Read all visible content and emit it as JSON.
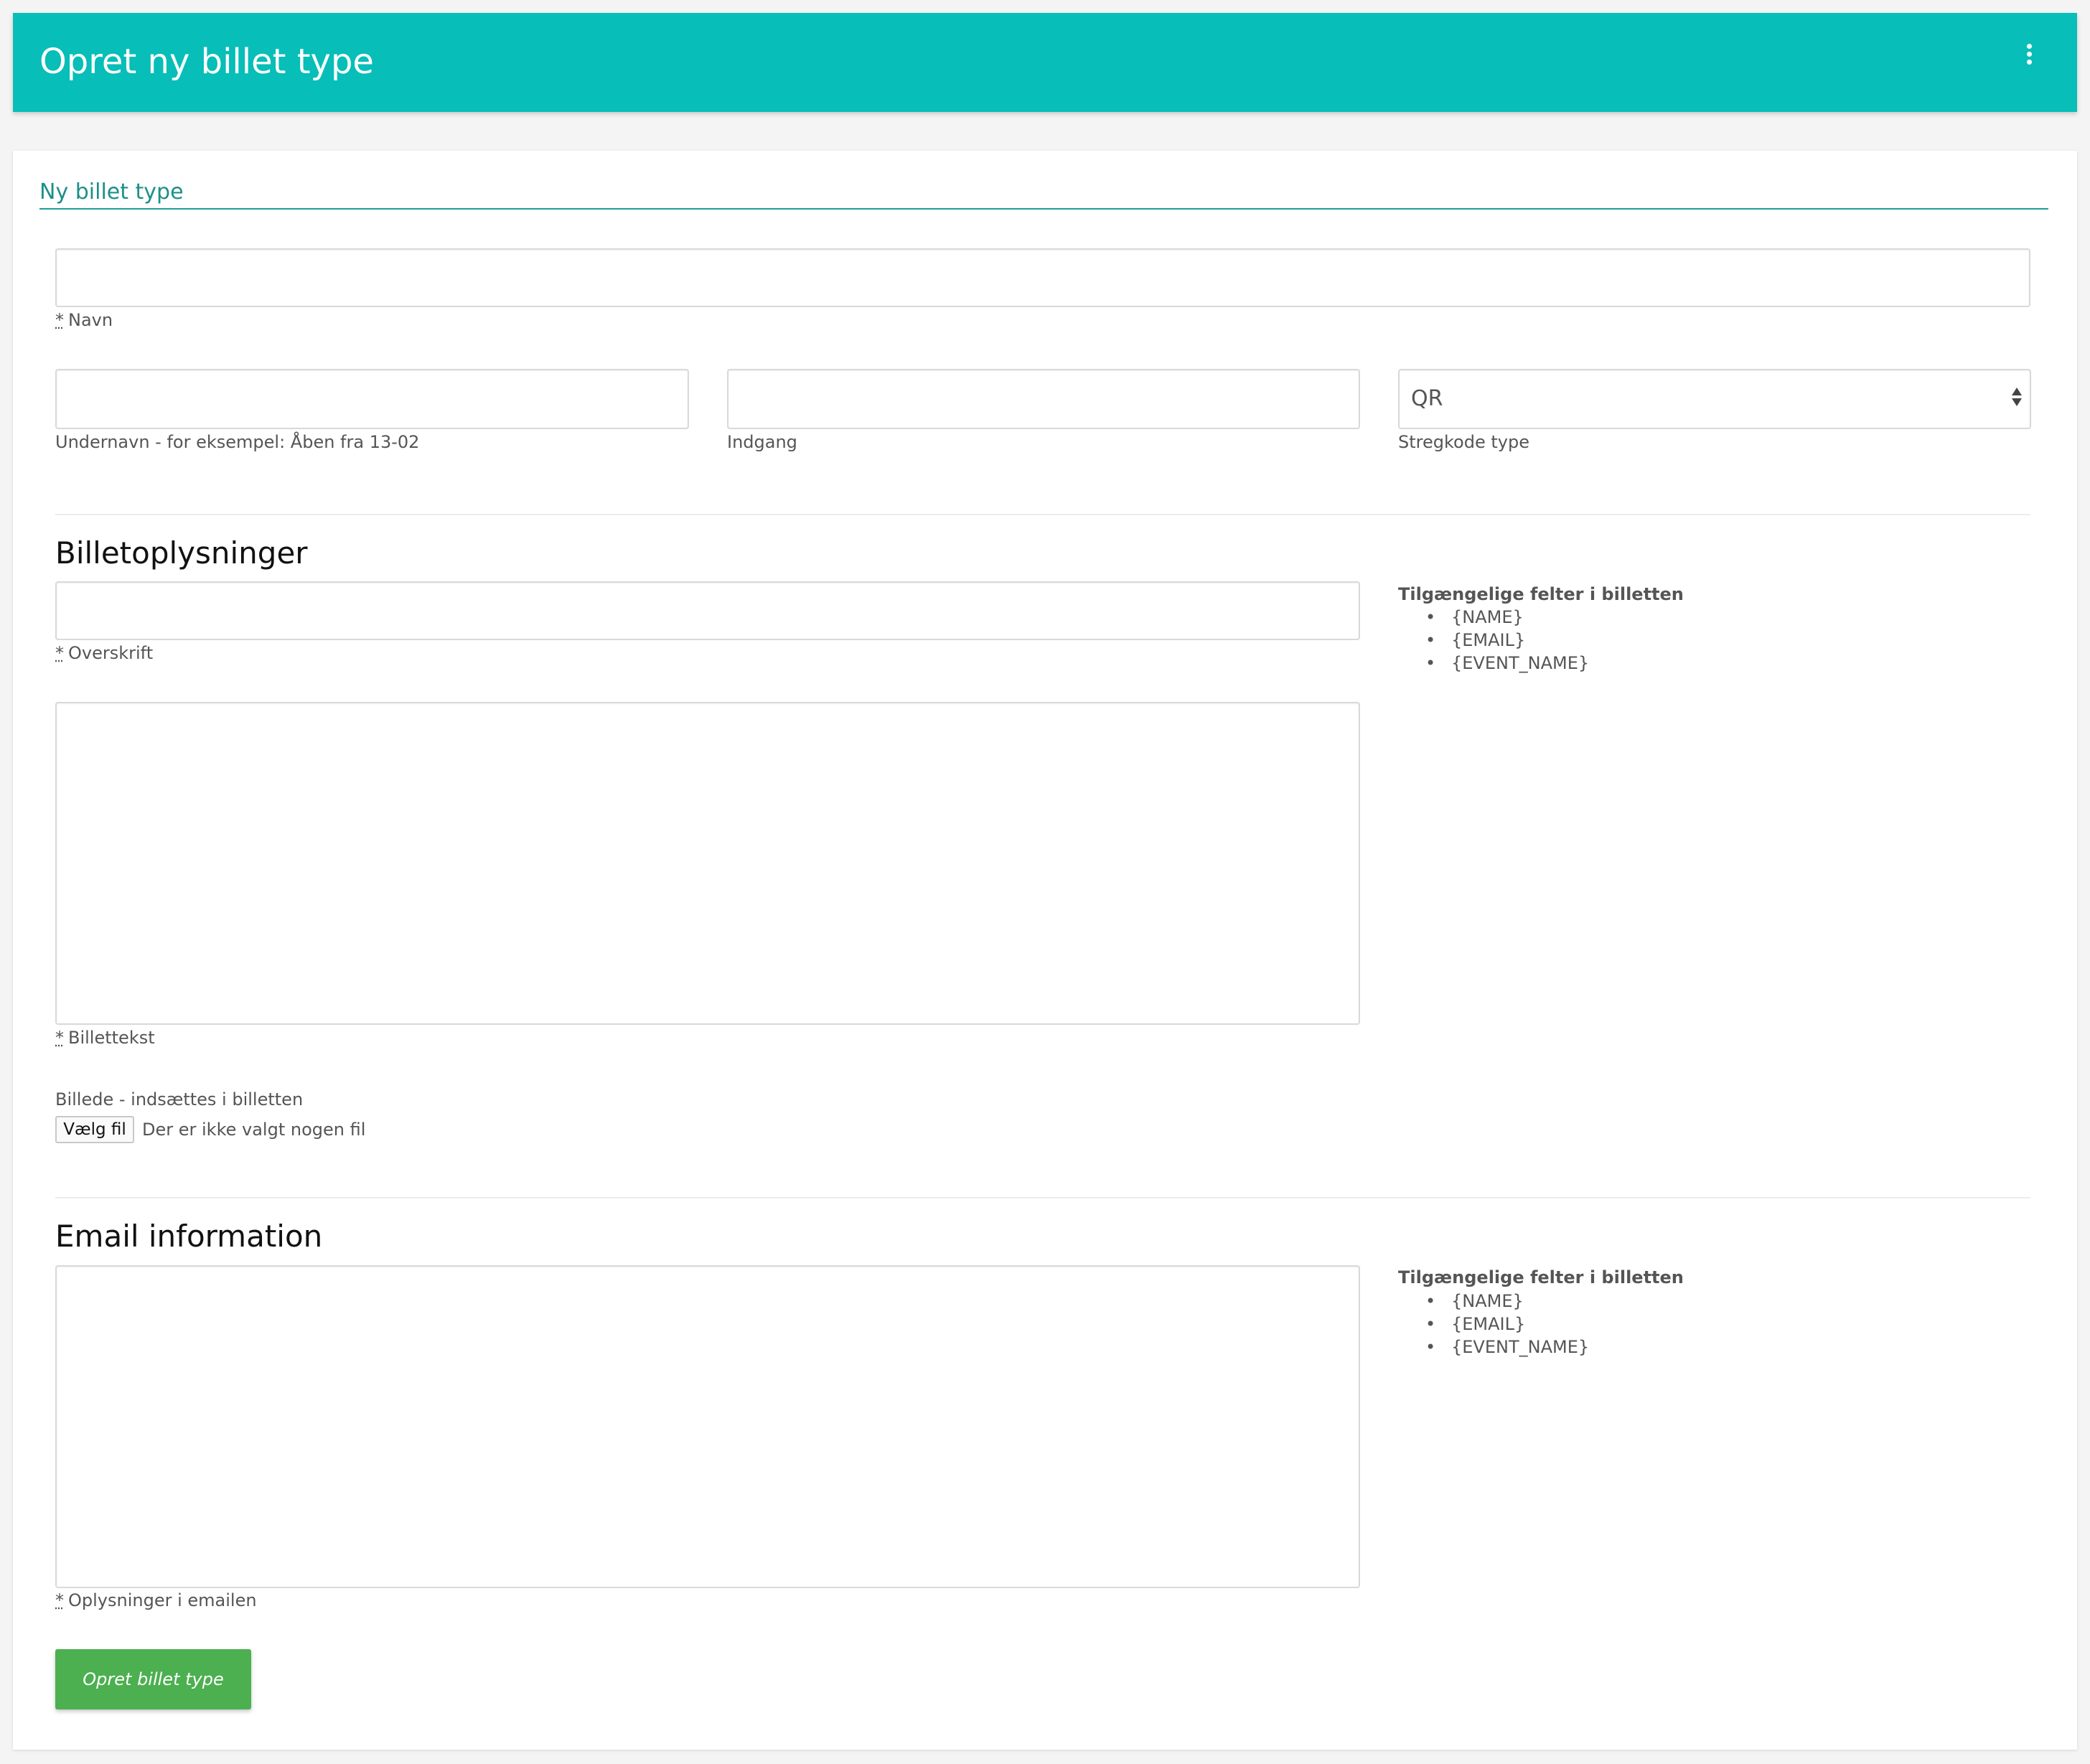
{
  "header": {
    "title": "Opret ny billet type",
    "menu_icon": "more-vertical-icon"
  },
  "form": {
    "title": "Ny billet type",
    "required_marker": "*",
    "name": {
      "label": "Navn",
      "value": ""
    },
    "subname": {
      "label": "Undernavn - for eksempel: Åben fra 13-02",
      "value": ""
    },
    "entrance": {
      "label": "Indgang",
      "value": ""
    },
    "barcode": {
      "label": "Stregkode type",
      "selected": "QR"
    }
  },
  "ticket_info": {
    "heading": "Billetoplysninger",
    "headline": {
      "label": "Overskrift",
      "value": ""
    },
    "text": {
      "label": "Billettekst",
      "value": ""
    },
    "image": {
      "label": "Billede - indsættes i billetten",
      "button": "Vælg fil",
      "status": "Der er ikke valgt nogen fil"
    },
    "fields_title": "Tilgængelige felter i billetten",
    "fields": [
      "{NAME}",
      "{EMAIL}",
      "{EVENT_NAME}"
    ]
  },
  "email_info": {
    "heading": "Email information",
    "body": {
      "label": "Oplysninger i emailen",
      "value": ""
    },
    "fields_title": "Tilgængelige felter i billetten",
    "fields": [
      "{NAME}",
      "{EMAIL}",
      "{EVENT_NAME}"
    ]
  },
  "submit": {
    "label": "Opret billet type"
  },
  "colors": {
    "header": "#07beb8",
    "accent": "#1d8f8a",
    "submit": "#4caf50"
  }
}
